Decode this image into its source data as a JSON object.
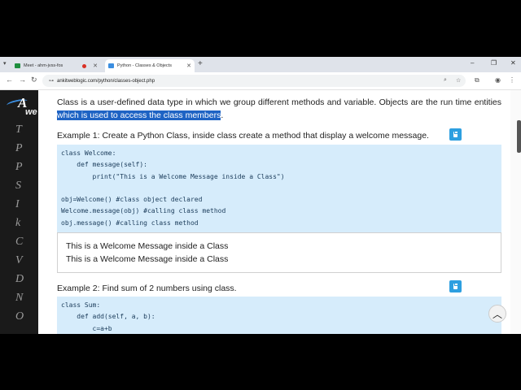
{
  "tabs": [
    {
      "title": "Meet - ahm-jvss-fos",
      "close": "✕"
    },
    {
      "title": "Python - Classes & Objects",
      "close": "✕"
    }
  ],
  "new_tab": "+",
  "address": {
    "url": "ankitweblogic.com/python/classes-object.php"
  },
  "sidebar": {
    "logo_big": "A",
    "logo_small": "we",
    "letters": [
      "T",
      "P",
      "P",
      "S",
      "I",
      "k",
      "C",
      "V",
      "D",
      "N",
      "O"
    ]
  },
  "intro": {
    "before": "Class is a user-defined data type in which we group different methods and variable. Objects are the run time entities ",
    "highlight": "which is used to access the class members",
    "after": "."
  },
  "example1": {
    "title": "Example 1: Create a Python Class, inside class create a method that display a welcome message.",
    "code": [
      "class Welcome:",
      "    def message(self):",
      "        print(\"This is a Welcome Message inside a Class\")",
      "",
      "obj=Welcome() #class object declared",
      "Welcome.message(obj) #calling class method",
      "obj.message() #calling class method"
    ],
    "output": [
      "This is a Welcome Message inside a Class",
      "This is a Welcome Message inside a Class"
    ]
  },
  "example2": {
    "title": "Example 2: Find sum of 2 numbers using class.",
    "code": [
      "class Sum:",
      "    def add(self, a, b):",
      "        c=a+b"
    ]
  },
  "colors": {
    "accent": "#2d9fe0",
    "highlight": "#1e63c4",
    "code_bg": "#d6ecfb",
    "sidebar_bg": "#1a1a1a"
  }
}
